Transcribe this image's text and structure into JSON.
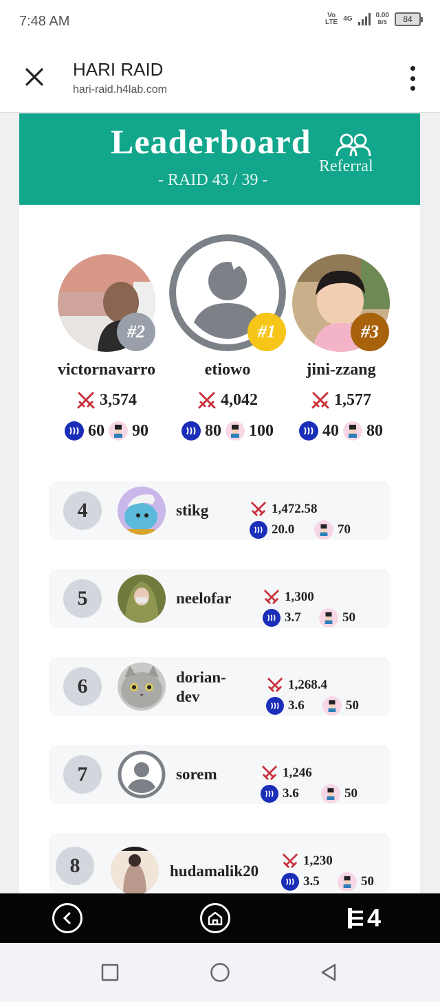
{
  "status_bar": {
    "time": "7:48 AM",
    "volte_top": "Vo",
    "volte_bottom": "LTE",
    "network": "4G",
    "speed_top": "0.00",
    "speed_bottom": "B/S",
    "battery": "84"
  },
  "browser": {
    "title": "HARI RAID",
    "url": "hari-raid.h4lab.com"
  },
  "banner": {
    "title": "Leaderboard",
    "subtitle": "- RAID 43 / 39 -",
    "referral_label": "Referral"
  },
  "podium": [
    {
      "badge": "#2",
      "name": "victornavarro",
      "score": "3,574",
      "steem": "60",
      "pets": "90",
      "badge_color": "#9aa0aa"
    },
    {
      "badge": "#1",
      "name": "etiowo",
      "score": "4,042",
      "steem": "80",
      "pets": "100",
      "badge_color": "#f5c518"
    },
    {
      "badge": "#3",
      "name": "jini-zzang",
      "score": "1,577",
      "steem": "40",
      "pets": "80",
      "badge_color": "#a8620b"
    }
  ],
  "rows": [
    {
      "rank": "4",
      "name": "stikg",
      "score": "1,472.58",
      "steem": "20.0",
      "pets": "70"
    },
    {
      "rank": "5",
      "name": "neelofar",
      "score": "1,300",
      "steem": "3.7",
      "pets": "50"
    },
    {
      "rank": "6",
      "name_line1": "dorian-",
      "name_line2": "dev",
      "score": "1,268.4",
      "steem": "3.6",
      "pets": "50"
    },
    {
      "rank": "7",
      "name": "sorem",
      "score": "1,246",
      "steem": "3.6",
      "pets": "50"
    },
    {
      "rank": "8",
      "name": "hudamalik20",
      "score": "1,230",
      "steem": "3.5",
      "pets": "50"
    }
  ],
  "app_bar": {
    "logo_text": "4"
  },
  "colors": {
    "banner": "#12a68c",
    "steem_coin": "#1a2eb8",
    "sword": "#c8323c"
  },
  "icons": [
    "close-icon",
    "more-vert-icon",
    "referral-people-icon",
    "sword-icon",
    "steem-coin-icon",
    "pet-icon",
    "back-icon",
    "home-icon",
    "recent-apps-icon",
    "system-home-icon",
    "system-back-icon"
  ]
}
